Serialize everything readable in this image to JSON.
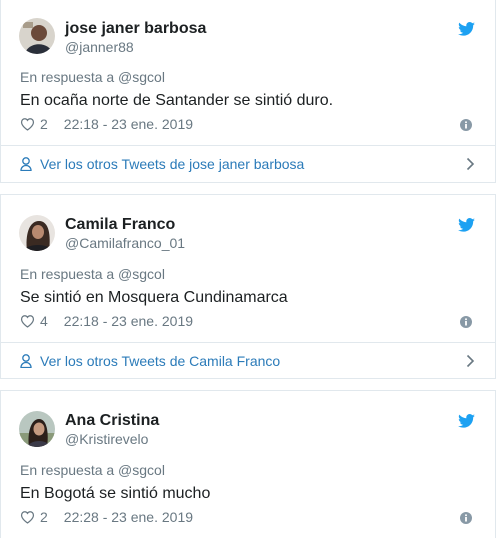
{
  "tweets": [
    {
      "name": "jose janer barbosa",
      "handle": "@janner88",
      "reply_to": "En respuesta a @sgcol",
      "text": "En ocaña norte de Santander se sintió duro.",
      "likes": "2",
      "timestamp": "22:18 - 23 ene. 2019",
      "more_link": "Ver los otros Tweets de jose janer barbosa"
    },
    {
      "name": "Camila Franco",
      "handle": "@Camilafranco_01",
      "reply_to": "En respuesta a @sgcol",
      "text": "Se sintió en Mosquera Cundinamarca",
      "likes": "4",
      "timestamp": "22:18 - 23 ene. 2019",
      "more_link": "Ver los otros Tweets de Camila Franco"
    },
    {
      "name": "Ana Cristina",
      "handle": "@Kristirevelo",
      "reply_to": "En respuesta a @sgcol",
      "text": "En Bogotá se sintió mucho",
      "likes": "2",
      "timestamp": "22:28 - 23 ene. 2019"
    }
  ],
  "colors": {
    "twitter_blue": "#1da1f2",
    "link_blue": "#2b7bb9",
    "muted_text": "#697882",
    "border": "#e1e8ed"
  },
  "icons": [
    "twitter-bird-icon",
    "heart-icon",
    "info-icon",
    "person-icon",
    "chevron-right-icon"
  ]
}
